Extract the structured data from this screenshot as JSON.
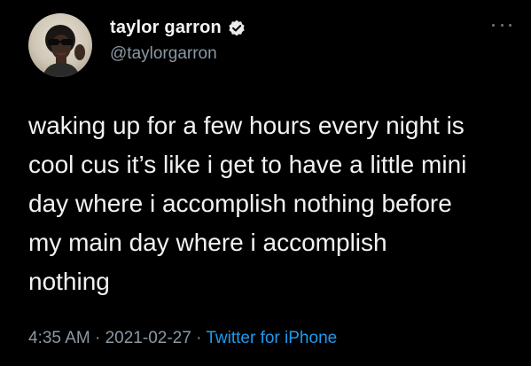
{
  "tweet": {
    "author": {
      "display_name": "taylor garron",
      "handle": "@taylorgarron",
      "verified": true,
      "avatar_icon": "profile-photo"
    },
    "text": "waking up for a few hours every night is\ncool cus it’s like i get to have a little mini\nday where i accomplish nothing before\nmy main day where i accomplish\nnothing",
    "time": "4:35 AM",
    "separator": "·",
    "date": "2021-02-27",
    "source": "Twitter for iPhone"
  },
  "colors": {
    "background": "#000000",
    "text": "#f2f2f2",
    "secondary": "#8b98a5",
    "link": "#1d9bf0",
    "verified_badge": "#e7e9ea"
  },
  "icons": {
    "verified": "verified-badge-icon",
    "more": "more-options-icon"
  }
}
